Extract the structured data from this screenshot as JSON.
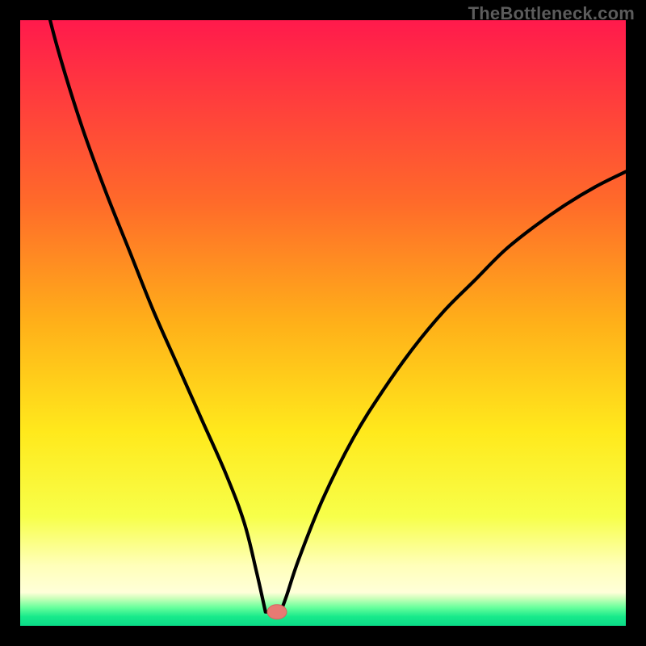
{
  "watermark": "TheBottleneck.com",
  "colors": {
    "frame": "#000000",
    "watermark": "#5c5c5c",
    "curve": "#000000",
    "marker_fill": "#e77a73",
    "marker_stroke": "#d46560",
    "gradient_stops": [
      {
        "offset": 0.0,
        "color": "#ff1a4c"
      },
      {
        "offset": 0.12,
        "color": "#ff3a3e"
      },
      {
        "offset": 0.3,
        "color": "#ff6a2a"
      },
      {
        "offset": 0.5,
        "color": "#ffb019"
      },
      {
        "offset": 0.68,
        "color": "#ffe91c"
      },
      {
        "offset": 0.82,
        "color": "#f7ff4a"
      },
      {
        "offset": 0.9,
        "color": "#ffffb9"
      },
      {
        "offset": 0.945,
        "color": "#ffffd9"
      },
      {
        "offset": 0.955,
        "color": "#c8ffb9"
      },
      {
        "offset": 0.97,
        "color": "#66ff9c"
      },
      {
        "offset": 0.985,
        "color": "#17e98b"
      },
      {
        "offset": 1.0,
        "color": "#0bdb87"
      }
    ]
  },
  "chart_data": {
    "type": "line",
    "title": "",
    "xlabel": "",
    "ylabel": "",
    "xlim": [
      0,
      100
    ],
    "ylim": [
      0,
      100
    ],
    "note": "V-shaped bottleneck curve. y approximates bottleneck % (100 = worst, 0 = perfect match). Minimum plateau around x≈40.5–43.",
    "series": [
      {
        "name": "bottleneck-curve",
        "x": [
          0,
          3,
          6,
          10,
          14,
          18,
          22,
          26,
          30,
          34,
          37,
          39,
          40.5,
          41.8,
          43,
          44,
          46,
          50,
          55,
          60,
          65,
          70,
          75,
          80,
          85,
          90,
          95,
          100
        ],
        "y": [
          120,
          108,
          96,
          83,
          72,
          62,
          52,
          43,
          34,
          25,
          17,
          9,
          2.3,
          2.3,
          2.3,
          5,
          11,
          21,
          31,
          39,
          46,
          52,
          57,
          62,
          66,
          69.5,
          72.5,
          75
        ]
      }
    ],
    "marker": {
      "x": 42.4,
      "y": 2.3,
      "rx": 1.6,
      "ry": 1.2
    }
  }
}
